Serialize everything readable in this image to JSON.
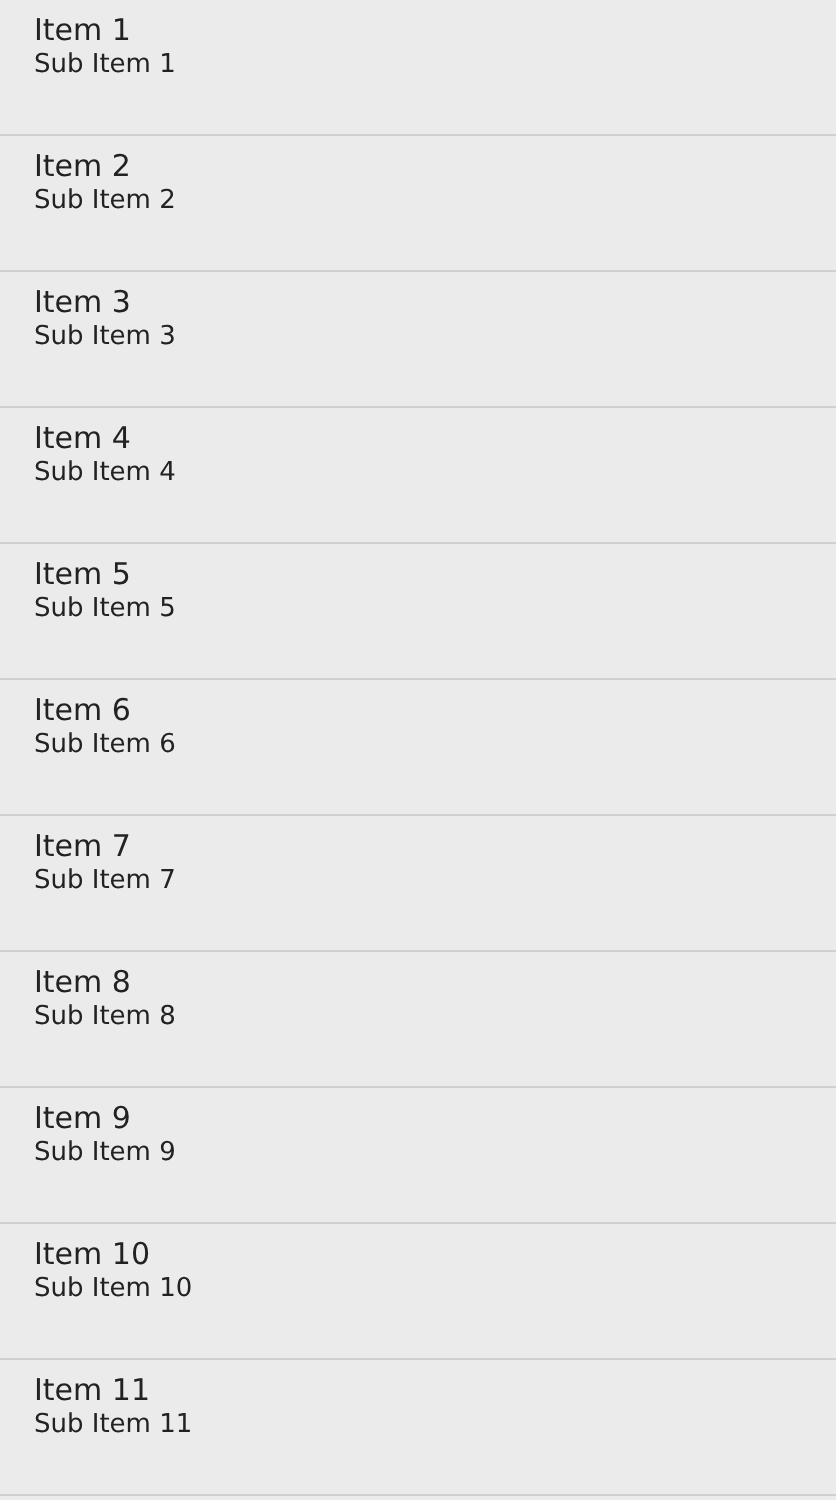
{
  "list": [
    {
      "title": "Item 1",
      "subtitle": "Sub Item 1"
    },
    {
      "title": "Item 2",
      "subtitle": "Sub Item 2"
    },
    {
      "title": "Item 3",
      "subtitle": "Sub Item 3"
    },
    {
      "title": "Item 4",
      "subtitle": "Sub Item 4"
    },
    {
      "title": "Item 5",
      "subtitle": "Sub Item 5"
    },
    {
      "title": "Item 6",
      "subtitle": "Sub Item 6"
    },
    {
      "title": "Item 7",
      "subtitle": "Sub Item 7"
    },
    {
      "title": "Item 8",
      "subtitle": "Sub Item 8"
    },
    {
      "title": "Item 9",
      "subtitle": "Sub Item 9"
    },
    {
      "title": "Item 10",
      "subtitle": "Sub Item 10"
    },
    {
      "title": "Item 11",
      "subtitle": "Sub Item 11"
    }
  ]
}
